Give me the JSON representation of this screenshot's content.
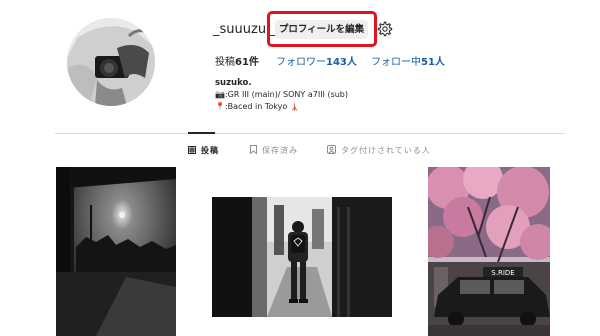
{
  "profile": {
    "username": "_suuuzu._",
    "edit_button_label": "プロフィールを編集",
    "settings_icon": "gear-icon",
    "stats": {
      "posts_label": "投稿",
      "posts_count": "61件",
      "followers_label": "フォロワー",
      "followers_count": "143人",
      "following_label": "フォロー中",
      "following_count": "51人"
    },
    "bio": {
      "display_name": "suzuko.",
      "line1": "📷:GR III (main)/ SONY a7III (sub)",
      "line2": "📍:Baced in Tokyo 🗼"
    }
  },
  "tabs": [
    {
      "label": "投稿",
      "icon": "grid-icon",
      "active": true
    },
    {
      "label": "保存済み",
      "icon": "bookmark-icon",
      "active": false
    },
    {
      "label": "タグ付けされている人",
      "icon": "tag-person-icon",
      "active": false
    }
  ],
  "colors": {
    "highlight_box": "#e0141e",
    "link_blue": "#1a5aa6",
    "button_bg": "#efefef"
  },
  "photos": [
    {
      "subject": "city-silhouette-sunset"
    },
    {
      "subject": "person-in-alley-backpack"
    },
    {
      "subject": "cherry-blossoms-taxi",
      "sign_text": "S.RIDE"
    }
  ]
}
